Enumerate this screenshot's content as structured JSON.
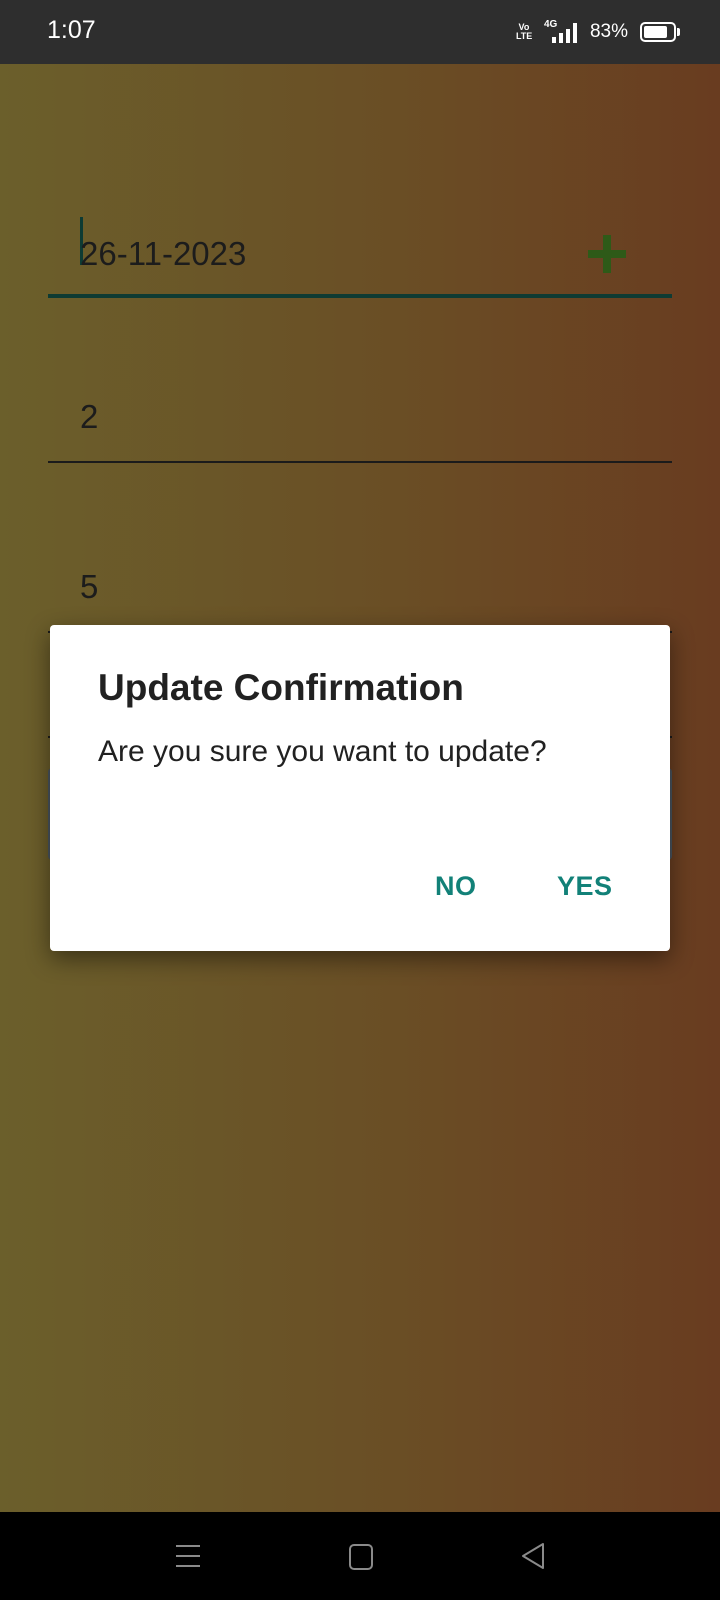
{
  "status_bar": {
    "time": "1:07",
    "volte_label": "Vo\nLTE",
    "network_label": "4G",
    "battery_percent": "83%",
    "battery_level": 0.83
  },
  "form": {
    "date_value": "26-11-2023",
    "field2_value": "2",
    "field3_value": "5",
    "add_icon": "plus-icon",
    "accent_color": "#0e3b33"
  },
  "dialog": {
    "title": "Update Confirmation",
    "message": "Are you sure you want to update?",
    "no_label": "NO",
    "yes_label": "YES",
    "button_color": "#128178"
  },
  "nav_bar": {
    "icons": [
      "menu-icon",
      "home-icon",
      "back-icon"
    ]
  }
}
